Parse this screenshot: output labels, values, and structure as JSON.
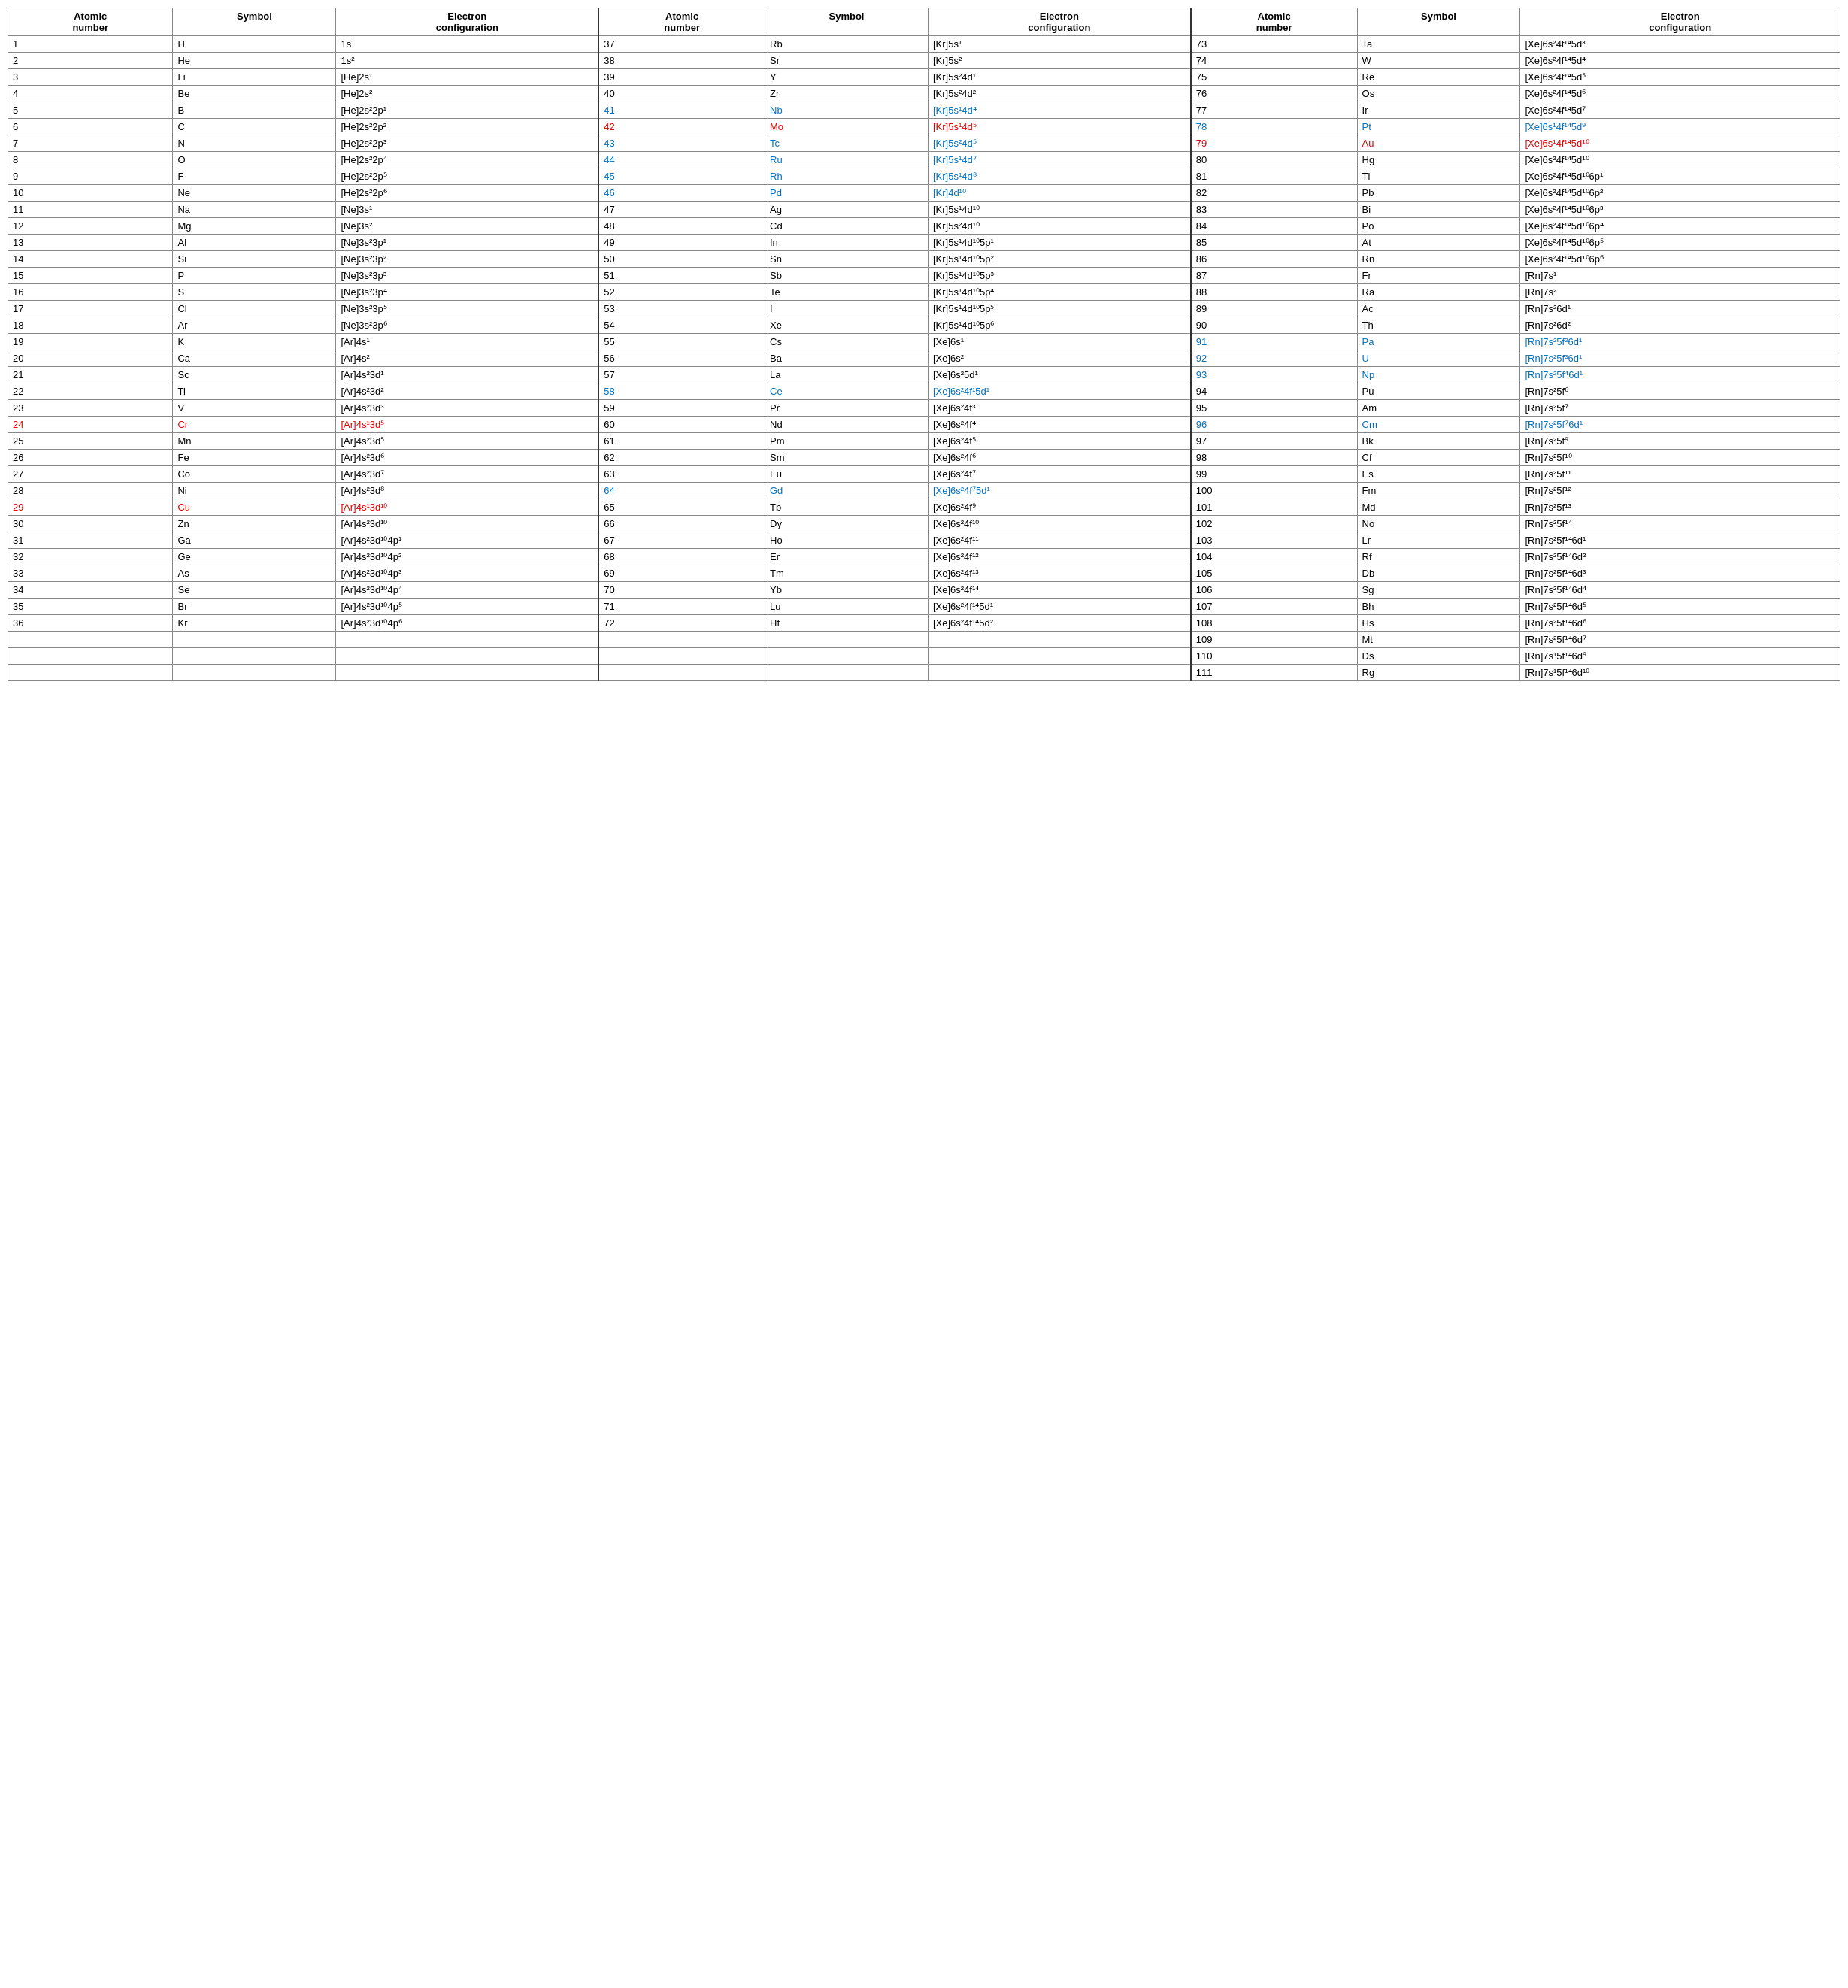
{
  "table": {
    "columns": [
      {
        "id": "atomic1",
        "label": "Atomic\nnumber"
      },
      {
        "id": "symbol1",
        "label": "Symbol"
      },
      {
        "id": "config1",
        "label": "Electron\nconfiguration"
      },
      {
        "id": "atomic2",
        "label": "Atomic\nnumber"
      },
      {
        "id": "symbol2",
        "label": "Symbol"
      },
      {
        "id": "config2",
        "label": "Electron\nconfiguration"
      },
      {
        "id": "atomic3",
        "label": "Atomic\nnumber"
      },
      {
        "id": "symbol3",
        "label": "Symbol"
      },
      {
        "id": "config3",
        "label": "Electron\nconfiguration"
      }
    ],
    "rows": [
      {
        "a1": "1",
        "s1": "H",
        "c1": "1s¹",
        "s1c": "black",
        "a1c": "black",
        "c1c": "black",
        "a2": "37",
        "s2": "Rb",
        "c2": "[Kr]5s¹",
        "s2c": "black",
        "a2c": "black",
        "c2c": "black",
        "a3": "73",
        "s3": "Ta",
        "c3": "[Xe]6s²4f¹⁴5d³",
        "s3c": "black",
        "a3c": "black",
        "c3c": "black"
      },
      {
        "a1": "2",
        "s1": "He",
        "c1": "1s²",
        "s1c": "black",
        "a1c": "black",
        "c1c": "black",
        "a2": "38",
        "s2": "Sr",
        "c2": "[Kr]5s²",
        "s2c": "black",
        "a2c": "black",
        "c2c": "black",
        "a3": "74",
        "s3": "W",
        "c3": "[Xe]6s²4f¹⁴5d⁴",
        "s3c": "black",
        "a3c": "black",
        "c3c": "black"
      },
      {
        "a1": "3",
        "s1": "Li",
        "c1": "[He]2s¹",
        "s1c": "black",
        "a1c": "black",
        "c1c": "black",
        "a2": "39",
        "s2": "Y",
        "c2": "[Kr]5s²4d¹",
        "s2c": "black",
        "a2c": "black",
        "c2c": "black",
        "a3": "75",
        "s3": "Re",
        "c3": "[Xe]6s²4f¹⁴5d⁵",
        "s3c": "black",
        "a3c": "black",
        "c3c": "black"
      },
      {
        "a1": "4",
        "s1": "Be",
        "c1": "[He]2s²",
        "s1c": "black",
        "a1c": "black",
        "c1c": "black",
        "a2": "40",
        "s2": "Zr",
        "c2": "[Kr]5s²4d²",
        "s2c": "black",
        "a2c": "black",
        "c2c": "black",
        "a3": "76",
        "s3": "Os",
        "c3": "[Xe]6s²4f¹⁴5d⁶",
        "s3c": "black",
        "a3c": "black",
        "c3c": "black"
      },
      {
        "a1": "5",
        "s1": "B",
        "c1": "[He]2s²2p¹",
        "s1c": "black",
        "a1c": "black",
        "c1c": "black",
        "a2": "41",
        "s2": "Nb",
        "c2": "[Kr]5s¹4d⁴",
        "s2c": "blue",
        "a2c": "blue",
        "c2c": "blue",
        "a3": "77",
        "s3": "Ir",
        "c3": "[Xe]6s²4f¹⁴5d⁷",
        "s3c": "black",
        "a3c": "black",
        "c3c": "black"
      },
      {
        "a1": "6",
        "s1": "C",
        "c1": "[He]2s²2p²",
        "s1c": "black",
        "a1c": "black",
        "c1c": "black",
        "a2": "42",
        "s2": "Mo",
        "c2": "[Kr]5s¹4d⁵",
        "s2c": "red",
        "a2c": "red",
        "c2c": "red",
        "a3": "78",
        "s3": "Pt",
        "c3": "[Xe]6s¹4f¹⁴5d⁹",
        "s3c": "blue",
        "a3c": "blue",
        "c3c": "blue"
      },
      {
        "a1": "7",
        "s1": "N",
        "c1": "[He]2s²2p³",
        "s1c": "black",
        "a1c": "black",
        "c1c": "black",
        "a2": "43",
        "s2": "Tc",
        "c2": "[Kr]5s²4d⁵",
        "s2c": "blue",
        "a2c": "blue",
        "c2c": "blue",
        "a3": "79",
        "s3": "Au",
        "c3": "[Xe]6s¹4f¹⁴5d¹⁰",
        "s3c": "red",
        "a3c": "red",
        "c3c": "red"
      },
      {
        "a1": "8",
        "s1": "O",
        "c1": "[He]2s²2p⁴",
        "s1c": "black",
        "a1c": "black",
        "c1c": "black",
        "a2": "44",
        "s2": "Ru",
        "c2": "[Kr]5s¹4d⁷",
        "s2c": "blue",
        "a2c": "blue",
        "c2c": "blue",
        "a3": "80",
        "s3": "Hg",
        "c3": "[Xe]6s²4f¹⁴5d¹⁰",
        "s3c": "black",
        "a3c": "black",
        "c3c": "black"
      },
      {
        "a1": "9",
        "s1": "F",
        "c1": "[He]2s²2p⁵",
        "s1c": "black",
        "a1c": "black",
        "c1c": "black",
        "a2": "45",
        "s2": "Rh",
        "c2": "[Kr]5s¹4d⁸",
        "s2c": "blue",
        "a2c": "blue",
        "c2c": "blue",
        "a3": "81",
        "s3": "Tl",
        "c3": "[Xe]6s²4f¹⁴5d¹⁰6p¹",
        "s3c": "black",
        "a3c": "black",
        "c3c": "black"
      },
      {
        "a1": "10",
        "s1": "Ne",
        "c1": "[He]2s²2p⁶",
        "s1c": "black",
        "a1c": "black",
        "c1c": "black",
        "a2": "46",
        "s2": "Pd",
        "c2": "[Kr]4d¹⁰",
        "s2c": "blue",
        "a2c": "blue",
        "c2c": "blue",
        "a3": "82",
        "s3": "Pb",
        "c3": "[Xe]6s²4f¹⁴5d¹⁰6p²",
        "s3c": "black",
        "a3c": "black",
        "c3c": "black"
      },
      {
        "a1": "11",
        "s1": "Na",
        "c1": "[Ne]3s¹",
        "s1c": "black",
        "a1c": "black",
        "c1c": "black",
        "a2": "47",
        "s2": "Ag",
        "c2": "[Kr]5s¹4d¹⁰",
        "s2c": "black",
        "a2c": "black",
        "c2c": "black",
        "a3": "83",
        "s3": "Bi",
        "c3": "[Xe]6s²4f¹⁴5d¹⁰6p³",
        "s3c": "black",
        "a3c": "black",
        "c3c": "black"
      },
      {
        "a1": "12",
        "s1": "Mg",
        "c1": "[Ne]3s²",
        "s1c": "black",
        "a1c": "black",
        "c1c": "black",
        "a2": "48",
        "s2": "Cd",
        "c2": "[Kr]5s²4d¹⁰",
        "s2c": "black",
        "a2c": "black",
        "c2c": "black",
        "a3": "84",
        "s3": "Po",
        "c3": "[Xe]6s²4f¹⁴5d¹⁰6p⁴",
        "s3c": "black",
        "a3c": "black",
        "c3c": "black"
      },
      {
        "a1": "13",
        "s1": "Al",
        "c1": "[Ne]3s²3p¹",
        "s1c": "black",
        "a1c": "black",
        "c1c": "black",
        "a2": "49",
        "s2": "In",
        "c2": "[Kr]5s¹4d¹⁰5p¹",
        "s2c": "black",
        "a2c": "black",
        "c2c": "black",
        "a3": "85",
        "s3": "At",
        "c3": "[Xe]6s²4f¹⁴5d¹⁰6p⁵",
        "s3c": "black",
        "a3c": "black",
        "c3c": "black"
      },
      {
        "a1": "14",
        "s1": "Si",
        "c1": "[Ne]3s²3p²",
        "s1c": "black",
        "a1c": "black",
        "c1c": "black",
        "a2": "50",
        "s2": "Sn",
        "c2": "[Kr]5s¹4d¹⁰5p²",
        "s2c": "black",
        "a2c": "black",
        "c2c": "black",
        "a3": "86",
        "s3": "Rn",
        "c3": "[Xe]6s²4f¹⁴5d¹⁰6p⁶",
        "s3c": "black",
        "a3c": "black",
        "c3c": "black"
      },
      {
        "a1": "15",
        "s1": "P",
        "c1": "[Ne]3s²3p³",
        "s1c": "black",
        "a1c": "black",
        "c1c": "black",
        "a2": "51",
        "s2": "Sb",
        "c2": "[Kr]5s¹4d¹⁰5p³",
        "s2c": "black",
        "a2c": "black",
        "c2c": "black",
        "a3": "87",
        "s3": "Fr",
        "c3": "[Rn]7s¹",
        "s3c": "black",
        "a3c": "black",
        "c3c": "black"
      },
      {
        "a1": "16",
        "s1": "S",
        "c1": "[Ne]3s²3p⁴",
        "s1c": "black",
        "a1c": "black",
        "c1c": "black",
        "a2": "52",
        "s2": "Te",
        "c2": "[Kr]5s¹4d¹⁰5p⁴",
        "s2c": "black",
        "a2c": "black",
        "c2c": "black",
        "a3": "88",
        "s3": "Ra",
        "c3": "[Rn]7s²",
        "s3c": "black",
        "a3c": "black",
        "c3c": "black"
      },
      {
        "a1": "17",
        "s1": "Cl",
        "c1": "[Ne]3s²3p⁵",
        "s1c": "black",
        "a1c": "black",
        "c1c": "black",
        "a2": "53",
        "s2": "I",
        "c2": "[Kr]5s¹4d¹⁰5p⁵",
        "s2c": "black",
        "a2c": "black",
        "c2c": "black",
        "a3": "89",
        "s3": "Ac",
        "c3": "[Rn]7s²6d¹",
        "s3c": "black",
        "a3c": "black",
        "c3c": "black"
      },
      {
        "a1": "18",
        "s1": "Ar",
        "c1": "[Ne]3s²3p⁶",
        "s1c": "black",
        "a1c": "black",
        "c1c": "black",
        "a2": "54",
        "s2": "Xe",
        "c2": "[Kr]5s¹4d¹⁰5p⁶",
        "s2c": "black",
        "a2c": "black",
        "c2c": "black",
        "a3": "90",
        "s3": "Th",
        "c3": "[Rn]7s²6d²",
        "s3c": "black",
        "a3c": "black",
        "c3c": "black"
      },
      {
        "a1": "19",
        "s1": "K",
        "c1": "[Ar]4s¹",
        "s1c": "black",
        "a1c": "black",
        "c1c": "black",
        "a2": "55",
        "s2": "Cs",
        "c2": "[Xe]6s¹",
        "s2c": "black",
        "a2c": "black",
        "c2c": "black",
        "a3": "91",
        "s3": "Pa",
        "c3": "[Rn]7s²5f²6d¹",
        "s3c": "blue",
        "a3c": "blue",
        "c3c": "blue"
      },
      {
        "a1": "20",
        "s1": "Ca",
        "c1": "[Ar]4s²",
        "s1c": "black",
        "a1c": "black",
        "c1c": "black",
        "a2": "56",
        "s2": "Ba",
        "c2": "[Xe]6s²",
        "s2c": "black",
        "a2c": "black",
        "c2c": "black",
        "a3": "92",
        "s3": "U",
        "c3": "[Rn]7s²5f³6d¹",
        "s3c": "blue",
        "a3c": "blue",
        "c3c": "blue"
      },
      {
        "a1": "21",
        "s1": "Sc",
        "c1": "[Ar]4s²3d¹",
        "s1c": "black",
        "a1c": "black",
        "c1c": "black",
        "a2": "57",
        "s2": "La",
        "c2": "[Xe]6s²5d¹",
        "s2c": "black",
        "a2c": "black",
        "c2c": "black",
        "a3": "93",
        "s3": "Np",
        "c3": "[Rn]7s²5f⁴6d¹",
        "s3c": "blue",
        "a3c": "blue",
        "c3c": "blue"
      },
      {
        "a1": "22",
        "s1": "Ti",
        "c1": "[Ar]4s²3d²",
        "s1c": "black",
        "a1c": "black",
        "c1c": "black",
        "a2": "58",
        "s2": "Ce",
        "c2": "[Xe]6s²4f¹5d¹",
        "s2c": "blue",
        "a2c": "blue",
        "c2c": "blue",
        "a3": "94",
        "s3": "Pu",
        "c3": "[Rn]7s²5f⁶",
        "s3c": "black",
        "a3c": "black",
        "c3c": "black"
      },
      {
        "a1": "23",
        "s1": "V",
        "c1": "[Ar]4s²3d³",
        "s1c": "black",
        "a1c": "black",
        "c1c": "black",
        "a2": "59",
        "s2": "Pr",
        "c2": "[Xe]6s²4f³",
        "s2c": "black",
        "a2c": "black",
        "c2c": "black",
        "a3": "95",
        "s3": "Am",
        "c3": "[Rn]7s²5f⁷",
        "s3c": "black",
        "a3c": "black",
        "c3c": "black"
      },
      {
        "a1": "24",
        "s1": "Cr",
        "c1": "[Ar]4s¹3d⁵",
        "s1c": "red",
        "a1c": "red",
        "c1c": "red",
        "a2": "60",
        "s2": "Nd",
        "c2": "[Xe]6s²4f⁴",
        "s2c": "black",
        "a2c": "black",
        "c2c": "black",
        "a3": "96",
        "s3": "Cm",
        "c3": "[Rn]7s²5f⁷6d¹",
        "s3c": "blue",
        "a3c": "blue",
        "c3c": "blue"
      },
      {
        "a1": "25",
        "s1": "Mn",
        "c1": "[Ar]4s²3d⁵",
        "s1c": "black",
        "a1c": "black",
        "c1c": "black",
        "a2": "61",
        "s2": "Pm",
        "c2": "[Xe]6s²4f⁵",
        "s2c": "black",
        "a2c": "black",
        "c2c": "black",
        "a3": "97",
        "s3": "Bk",
        "c3": "[Rn]7s²5f⁹",
        "s3c": "black",
        "a3c": "black",
        "c3c": "black"
      },
      {
        "a1": "26",
        "s1": "Fe",
        "c1": "[Ar]4s²3d⁶",
        "s1c": "black",
        "a1c": "black",
        "c1c": "black",
        "a2": "62",
        "s2": "Sm",
        "c2": "[Xe]6s²4f⁶",
        "s2c": "black",
        "a2c": "black",
        "c2c": "black",
        "a3": "98",
        "s3": "Cf",
        "c3": "[Rn]7s²5f¹⁰",
        "s3c": "black",
        "a3c": "black",
        "c3c": "black"
      },
      {
        "a1": "27",
        "s1": "Co",
        "c1": "[Ar]4s²3d⁷",
        "s1c": "black",
        "a1c": "black",
        "c1c": "black",
        "a2": "63",
        "s2": "Eu",
        "c2": "[Xe]6s²4f⁷",
        "s2c": "black",
        "a2c": "black",
        "c2c": "black",
        "a3": "99",
        "s3": "Es",
        "c3": "[Rn]7s²5f¹¹",
        "s3c": "black",
        "a3c": "black",
        "c3c": "black"
      },
      {
        "a1": "28",
        "s1": "Ni",
        "c1": "[Ar]4s²3d⁸",
        "s1c": "black",
        "a1c": "black",
        "c1c": "black",
        "a2": "64",
        "s2": "Gd",
        "c2": "[Xe]6s²4f⁷5d¹",
        "s2c": "blue",
        "a2c": "blue",
        "c2c": "blue",
        "a3": "100",
        "s3": "Fm",
        "c3": "[Rn]7s²5f¹²",
        "s3c": "black",
        "a3c": "black",
        "c3c": "black"
      },
      {
        "a1": "29",
        "s1": "Cu",
        "c1": "[Ar]4s¹3d¹⁰",
        "s1c": "red",
        "a1c": "red",
        "c1c": "red",
        "a2": "65",
        "s2": "Tb",
        "c2": "[Xe]6s²4f⁹",
        "s2c": "black",
        "a2c": "black",
        "c2c": "black",
        "a3": "101",
        "s3": "Md",
        "c3": "[Rn]7s²5f¹³",
        "s3c": "black",
        "a3c": "black",
        "c3c": "black"
      },
      {
        "a1": "30",
        "s1": "Zn",
        "c1": "[Ar]4s²3d¹⁰",
        "s1c": "black",
        "a1c": "black",
        "c1c": "black",
        "a2": "66",
        "s2": "Dy",
        "c2": "[Xe]6s²4f¹⁰",
        "s2c": "black",
        "a2c": "black",
        "c2c": "black",
        "a3": "102",
        "s3": "No",
        "c3": "[Rn]7s²5f¹⁴",
        "s3c": "black",
        "a3c": "black",
        "c3c": "black"
      },
      {
        "a1": "31",
        "s1": "Ga",
        "c1": "[Ar]4s²3d¹⁰4p¹",
        "s1c": "black",
        "a1c": "black",
        "c1c": "black",
        "a2": "67",
        "s2": "Ho",
        "c2": "[Xe]6s²4f¹¹",
        "s2c": "black",
        "a2c": "black",
        "c2c": "black",
        "a3": "103",
        "s3": "Lr",
        "c3": "[Rn]7s²5f¹⁴6d¹",
        "s3c": "black",
        "a3c": "black",
        "c3c": "black"
      },
      {
        "a1": "32",
        "s1": "Ge",
        "c1": "[Ar]4s²3d¹⁰4p²",
        "s1c": "black",
        "a1c": "black",
        "c1c": "black",
        "a2": "68",
        "s2": "Er",
        "c2": "[Xe]6s²4f¹²",
        "s2c": "black",
        "a2c": "black",
        "c2c": "black",
        "a3": "104",
        "s3": "Rf",
        "c3": "[Rn]7s²5f¹⁴6d²",
        "s3c": "black",
        "a3c": "black",
        "c3c": "black"
      },
      {
        "a1": "33",
        "s1": "As",
        "c1": "[Ar]4s²3d¹⁰4p³",
        "s1c": "black",
        "a1c": "black",
        "c1c": "black",
        "a2": "69",
        "s2": "Tm",
        "c2": "[Xe]6s²4f¹³",
        "s2c": "black",
        "a2c": "black",
        "c2c": "black",
        "a3": "105",
        "s3": "Db",
        "c3": "[Rn]7s²5f¹⁴6d³",
        "s3c": "black",
        "a3c": "black",
        "c3c": "black"
      },
      {
        "a1": "34",
        "s1": "Se",
        "c1": "[Ar]4s²3d¹⁰4p⁴",
        "s1c": "black",
        "a1c": "black",
        "c1c": "black",
        "a2": "70",
        "s2": "Yb",
        "c2": "[Xe]6s²4f¹⁴",
        "s2c": "black",
        "a2c": "black",
        "c2c": "black",
        "a3": "106",
        "s3": "Sg",
        "c3": "[Rn]7s²5f¹⁴6d⁴",
        "s3c": "black",
        "a3c": "black",
        "c3c": "black"
      },
      {
        "a1": "35",
        "s1": "Br",
        "c1": "[Ar]4s²3d¹⁰4p⁵",
        "s1c": "black",
        "a1c": "black",
        "c1c": "black",
        "a2": "71",
        "s2": "Lu",
        "c2": "[Xe]6s²4f¹⁴5d¹",
        "s2c": "black",
        "a2c": "black",
        "c2c": "black",
        "a3": "107",
        "s3": "Bh",
        "c3": "[Rn]7s²5f¹⁴6d⁵",
        "s3c": "black",
        "a3c": "black",
        "c3c": "black"
      },
      {
        "a1": "36",
        "s1": "Kr",
        "c1": "[Ar]4s²3d¹⁰4p⁶",
        "s1c": "black",
        "a1c": "black",
        "c1c": "black",
        "a2": "72",
        "s2": "Hf",
        "c2": "[Xe]6s²4f¹⁴5d²",
        "s2c": "black",
        "a2c": "black",
        "c2c": "black",
        "a3": "108",
        "s3": "Hs",
        "c3": "[Rn]7s²5f¹⁴6d⁶",
        "s3c": "black",
        "a3c": "black",
        "c3c": "black"
      },
      {
        "a1": "",
        "s1": "",
        "c1": "",
        "s1c": "black",
        "a1c": "black",
        "c1c": "black",
        "a2": "",
        "s2": "",
        "c2": "",
        "s2c": "black",
        "a2c": "black",
        "c2c": "black",
        "a3": "109",
        "s3": "Mt",
        "c3": "[Rn]7s²5f¹⁴6d⁷",
        "s3c": "black",
        "a3c": "black",
        "c3c": "black"
      },
      {
        "a1": "",
        "s1": "",
        "c1": "",
        "s1c": "black",
        "a1c": "black",
        "c1c": "black",
        "a2": "",
        "s2": "",
        "c2": "",
        "s2c": "black",
        "a2c": "black",
        "c2c": "black",
        "a3": "110",
        "s3": "Ds",
        "c3": "[Rn]7s¹5f¹⁴6d⁹",
        "s3c": "black",
        "a3c": "black",
        "c3c": "black"
      },
      {
        "a1": "",
        "s1": "",
        "c1": "",
        "s1c": "black",
        "a1c": "black",
        "c1c": "black",
        "a2": "",
        "s2": "",
        "c2": "",
        "s2c": "black",
        "a2c": "black",
        "c2c": "black",
        "a3": "111",
        "s3": "Rg",
        "c3": "[Rn]7s¹5f¹⁴6d¹⁰",
        "s3c": "black",
        "a3c": "black",
        "c3c": "black"
      }
    ]
  }
}
